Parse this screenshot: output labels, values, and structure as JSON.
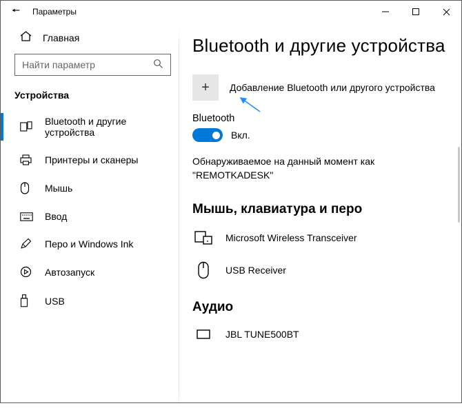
{
  "window": {
    "title": "Параметры"
  },
  "sidebar": {
    "home_label": "Главная",
    "search_placeholder": "Найти параметр",
    "section": "Устройства",
    "items": [
      {
        "label": "Bluetooth и другие устройства"
      },
      {
        "label": "Принтеры и сканеры"
      },
      {
        "label": "Мышь"
      },
      {
        "label": "Ввод"
      },
      {
        "label": "Перо и Windows Ink"
      },
      {
        "label": "Автозапуск"
      },
      {
        "label": "USB"
      }
    ]
  },
  "main": {
    "heading": "Bluetooth и другие устройства",
    "add_label": "Добавление Bluetooth или другого устройства",
    "bt_label": "Bluetooth",
    "bt_state": "Вкл.",
    "discover_text": "Обнаруживаемое на данный момент как \"REMOTKADESK\"",
    "group_mouse": "Мышь, клавиатура и перо",
    "device_transceiver": "Microsoft Wireless Transceiver",
    "device_usb_receiver": "USB Receiver",
    "group_audio": "Аудио",
    "device_jbl": "JBL TUNE500BT"
  }
}
